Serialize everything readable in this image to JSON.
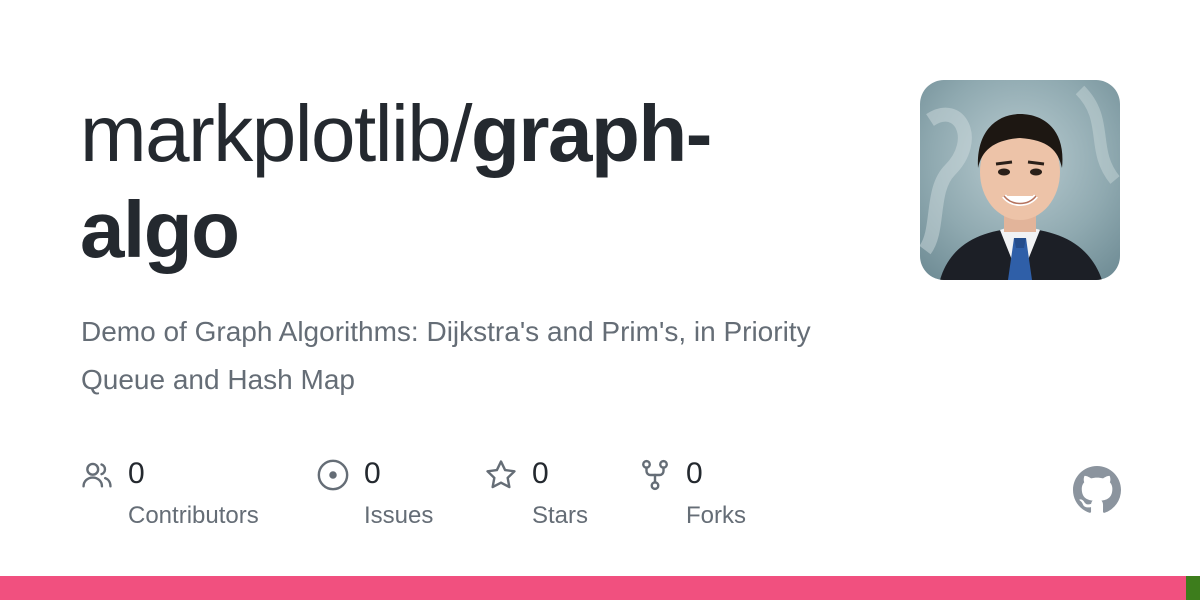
{
  "repo": {
    "owner": "markplotlib/",
    "name": "graph-algo",
    "description": "Demo of Graph Algorithms: Dijkstra's and Prim's, in Priority Queue and Hash Map"
  },
  "avatar": {
    "icon": "profile-photo"
  },
  "stats": {
    "contributors": {
      "count": "0",
      "label": "Contributors",
      "icon": "people-icon"
    },
    "issues": {
      "count": "0",
      "label": "Issues",
      "icon": "issue-opened-icon"
    },
    "stars": {
      "count": "0",
      "label": "Stars",
      "icon": "star-icon"
    },
    "forks": {
      "count": "0",
      "label": "Forks",
      "icon": "repo-forked-icon"
    }
  },
  "brand": {
    "icon": "github-mark-icon",
    "color": "#8b949e"
  },
  "languages": [
    {
      "color": "#f1507f",
      "share": 0.988
    },
    {
      "color": "#3d7d1c",
      "share": 0.012
    }
  ],
  "colors": {
    "title": "#24292f",
    "muted": "#656d76",
    "icon": "#656d76"
  }
}
